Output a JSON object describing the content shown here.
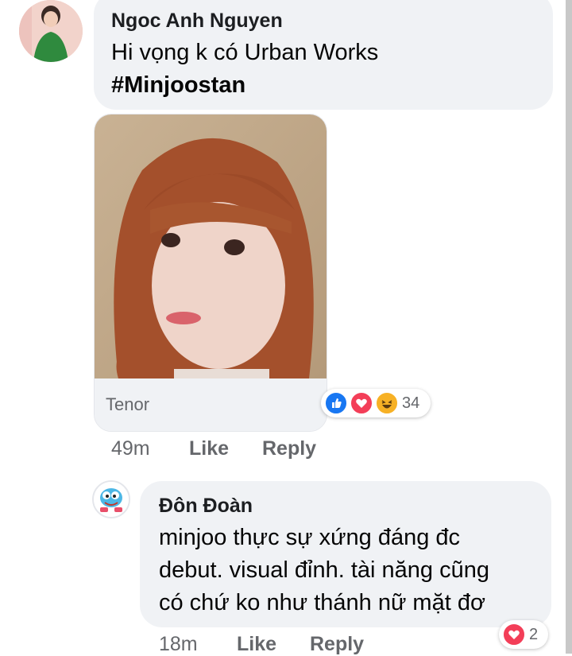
{
  "comment1": {
    "author": "Ngoc Anh Nguyen",
    "text_line1": "Hi vọng k có Urban Works",
    "hashtag": "#Minjoostan",
    "gif_source": "Tenor",
    "reaction_icons": [
      "like-icon",
      "love-icon",
      "haha-icon"
    ],
    "reaction_count": "34",
    "time": "49m",
    "like_label": "Like",
    "reply_label": "Reply"
  },
  "comment2": {
    "author": "Đôn Đoàn",
    "text_lines": [
      "minjoo thực sự xứng đáng đc",
      "debut. visual đỉnh. tài năng cũng",
      "có chứ ko như thánh nữ mặt đơ"
    ],
    "reaction_icons": [
      "love-icon"
    ],
    "reaction_count": "2",
    "time": "18m",
    "like_label": "Like",
    "reply_label": "Reply"
  },
  "colors": {
    "bubble": "#f0f2f5",
    "like_blue": "#1877f2",
    "love_red": "#f33e58",
    "haha_yellow": "#f7b125",
    "meta_gray": "#65676b"
  }
}
